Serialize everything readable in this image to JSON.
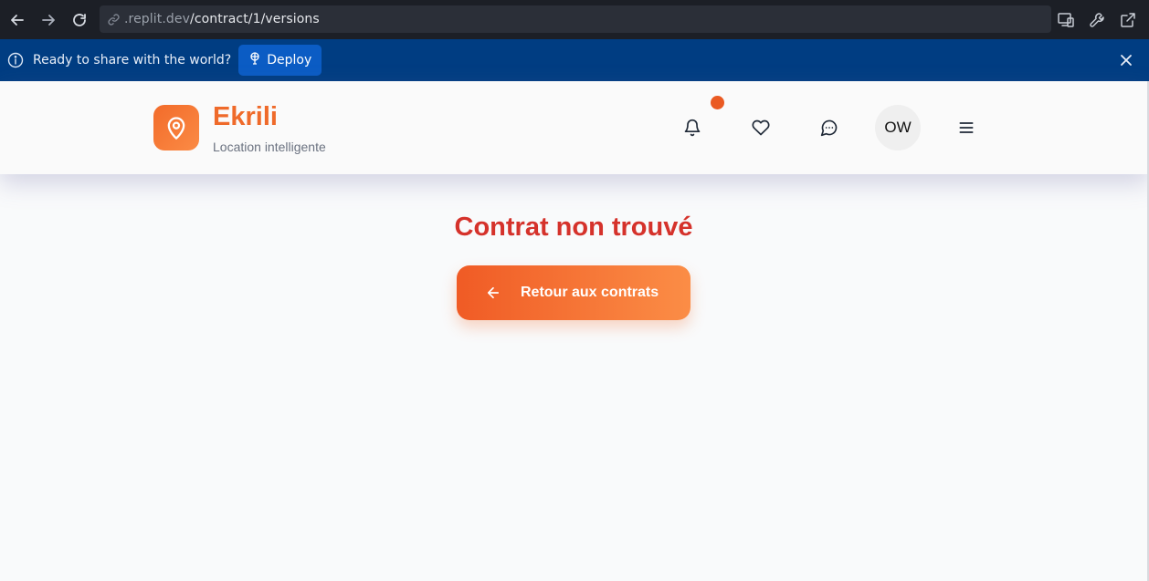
{
  "browser": {
    "url_prefix": ".replit.dev",
    "url_path": "/contract/1/versions",
    "icons": [
      "back-arrow-icon",
      "forward-arrow-icon",
      "reload-icon",
      "link-icon",
      "devices-icon",
      "wrench-icon",
      "open-external-icon"
    ]
  },
  "banner": {
    "text": "Ready to share with the world?",
    "deploy_label": "Deploy",
    "background": "#003d82"
  },
  "header": {
    "brand_name": "Ekrili",
    "brand_subtitle": "Location intelligente",
    "avatar_initials": "OW",
    "accent": "#ef6a2a",
    "icons": [
      "bell-icon",
      "heart-icon",
      "message-icon",
      "menu-icon"
    ]
  },
  "main": {
    "title": "Contrat non trouvé",
    "back_button_label": "Retour aux contrats",
    "title_color": "#d5322b"
  }
}
